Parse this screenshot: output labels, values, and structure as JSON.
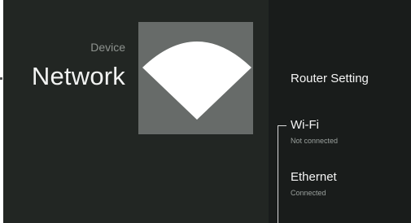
{
  "header": {
    "breadcrumb": "Device",
    "title": "Network"
  },
  "hero": {
    "icon": "wifi-icon"
  },
  "menu": {
    "items": [
      {
        "label": "Router Setting",
        "sublabel": ""
      },
      {
        "label": "Wi-Fi",
        "sublabel": "Not connected"
      },
      {
        "label": "Ethernet",
        "sublabel": "Connected"
      }
    ],
    "focused_index": 1
  },
  "colors": {
    "left_background": "#222623",
    "right_background": "#191c1b",
    "hero_tile": "#676b69",
    "wifi_fan": "#ffffff",
    "focus_line": "#d9d9d9"
  }
}
